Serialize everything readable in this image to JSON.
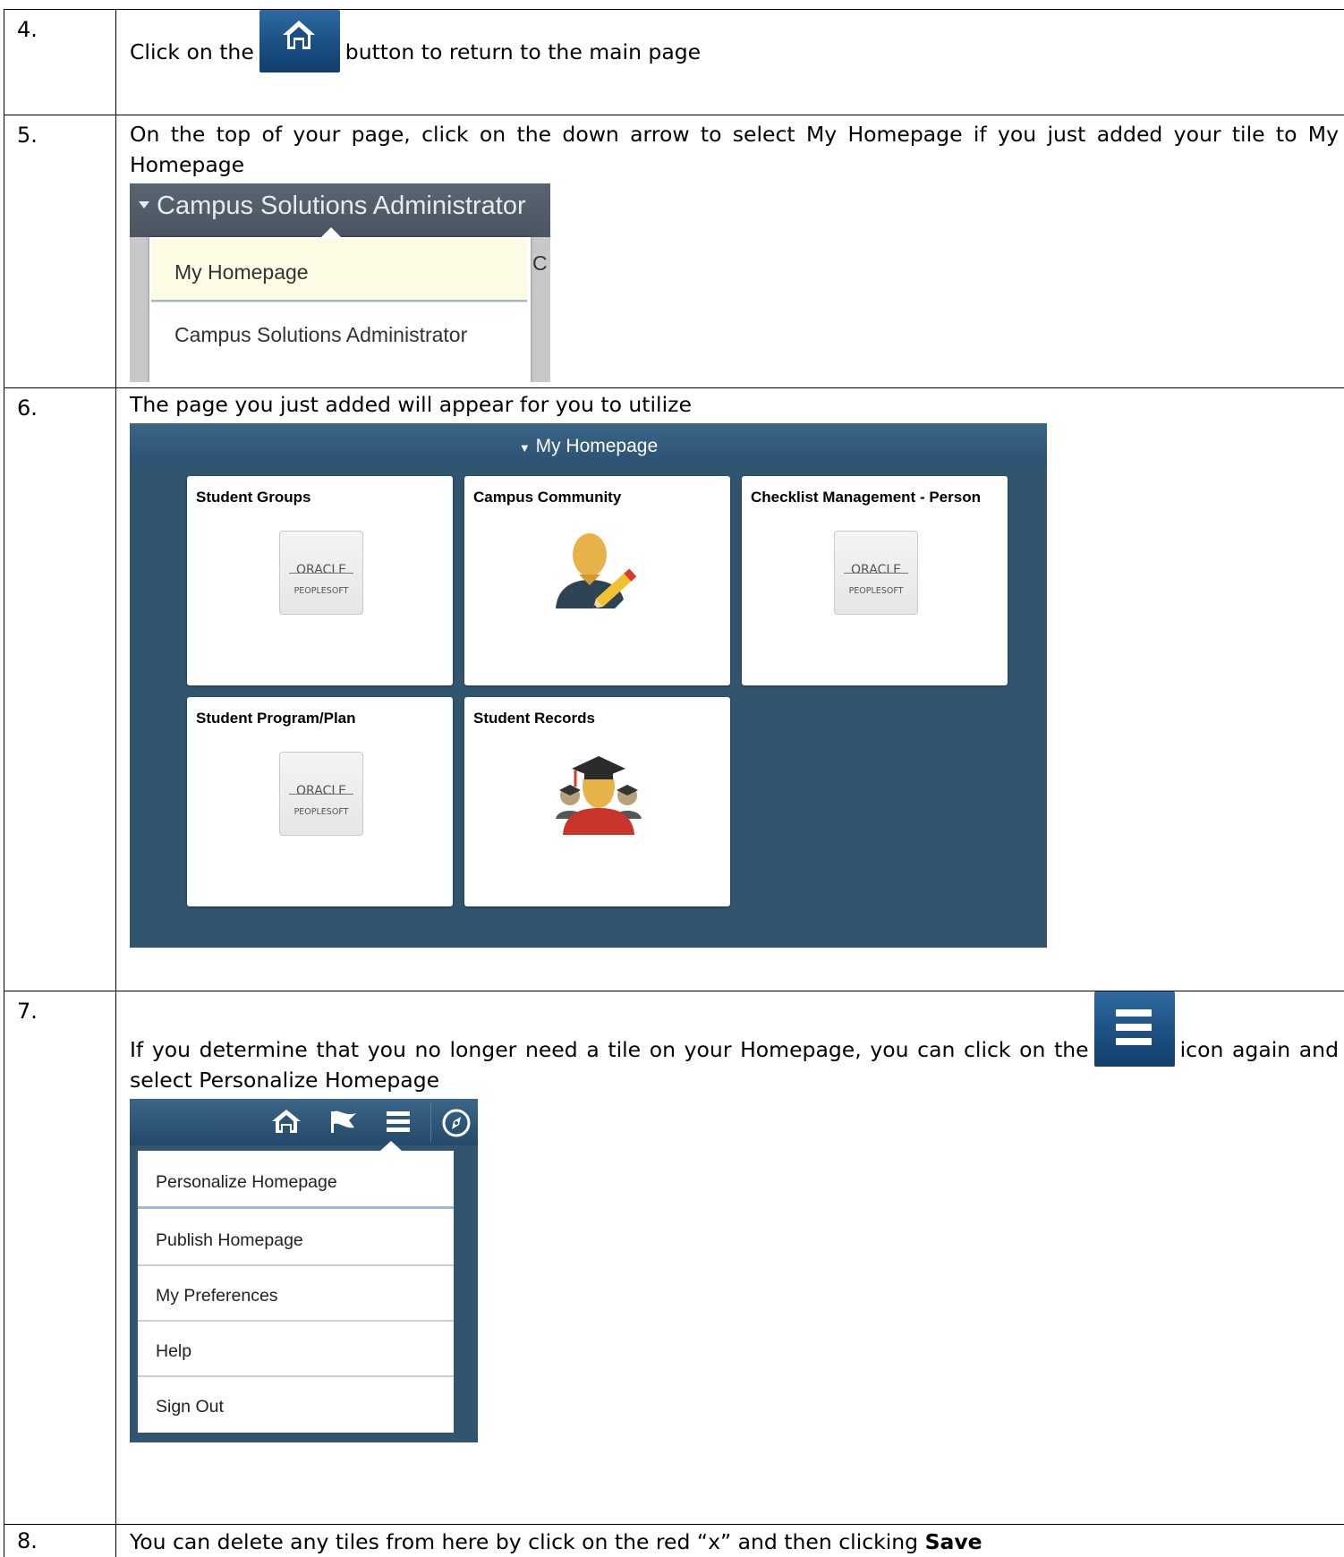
{
  "colors": {
    "tile_bg": "#31546f",
    "nav_blue": "#1c4f82",
    "selected_item": "#fdfbe3"
  },
  "rows": [
    {
      "num": "4.",
      "text_before": "Click on the",
      "text_after": "button to return to the main page",
      "inline_icon": "home-icon"
    },
    {
      "num": "5.",
      "text": "On the top of your page, click on the down arrow to select My Homepage if you just added your tile to My Homepage"
    },
    {
      "num": "6.",
      "text": "The page you just added will appear for you to utilize"
    },
    {
      "num": "7.",
      "text_before": "If you determine that you no longer need a tile on your Homepage, you can click on the",
      "text_after": "icon again and select Personalize Homepage",
      "inline_icon": "hamburger-menu-icon"
    },
    {
      "num": "8.",
      "text": "You can delete any tiles from here by click on the red “x” and then clicking",
      "bold": "Save"
    }
  ],
  "dropdown5": {
    "banner": "Campus Solutions Administrator",
    "items": [
      "My Homepage",
      "Campus Solutions Administrator"
    ],
    "peek": "C"
  },
  "homepage6": {
    "header": "My Homepage",
    "tiles": [
      {
        "title": "Student Groups",
        "icon": "oracle-peoplesoft-logo"
      },
      {
        "title": "Campus Community",
        "icon": "person-edit-icon"
      },
      {
        "title": "Checklist Management - Person",
        "icon": "oracle-peoplesoft-logo"
      },
      {
        "title": "Student Program/Plan",
        "icon": "oracle-peoplesoft-logo"
      },
      {
        "title": "Student Records",
        "icon": "graduate-icon"
      }
    ],
    "logo_top": "ORACLE",
    "logo_bottom": "PEOPLESOFT"
  },
  "navmenu7": {
    "icons": [
      "home-icon",
      "flag-icon",
      "hamburger-menu-icon",
      "compass-icon"
    ],
    "items": [
      "Personalize Homepage",
      "Publish Homepage",
      "My Preferences",
      "Help",
      "Sign Out"
    ]
  }
}
